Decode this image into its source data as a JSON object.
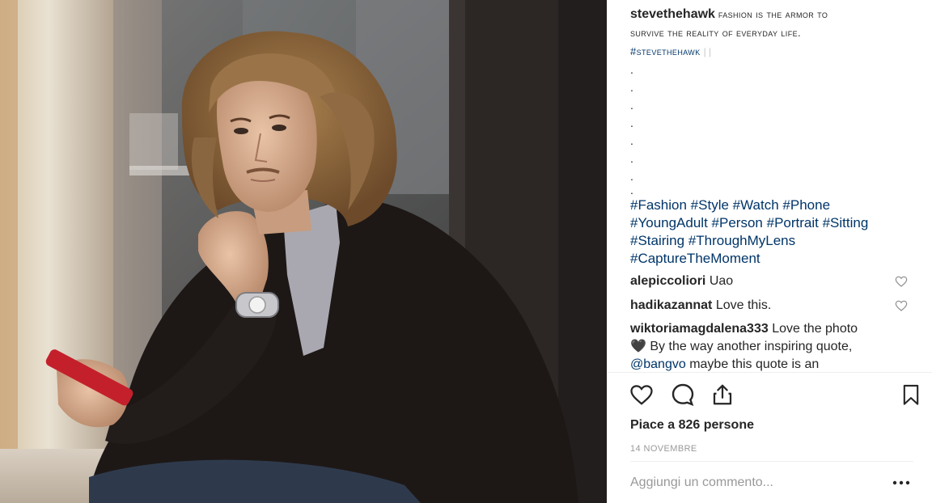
{
  "photo": {
    "icon": "portrait-photo"
  },
  "caption": {
    "username": "stevethehawk",
    "text_line1": "fashion is the armor to",
    "text_line2": "survive the reality of everyday life.",
    "tag": "#stevethehawk",
    "tag_sep": "| |",
    "dots": [
      ".",
      ".",
      ".",
      ".",
      ".",
      ".",
      ".",
      "."
    ],
    "hashtags": [
      [
        "#Fashion",
        "#Style",
        "#Watch",
        "#Phone"
      ],
      [
        "#YoungAdult",
        "#Person",
        "#Portrait",
        "#Sitting"
      ],
      [
        "#Stairing",
        "#ThroughMyLens"
      ],
      [
        "#CaptureTheMoment"
      ]
    ]
  },
  "comments": [
    {
      "user": "alepiccoliori",
      "text": "Uao"
    },
    {
      "user": "hadikazannat",
      "text": "Love this."
    },
    {
      "user": "wiktoriamagdalena333",
      "text": "Love the photo",
      "line2_emoji": "🖤",
      "line2_text": "By the way another inspiring quote,",
      "mention": "@bangvo",
      "line3_text": "maybe this quote is an"
    }
  ],
  "actions": {
    "likes_text": "Piace a 826 persone",
    "date": "14 NOVEMBRE"
  },
  "comment_box": {
    "placeholder": "Aggiungi un commento..."
  },
  "colors": {
    "link": "#003569",
    "text": "#262626",
    "muted": "#999999",
    "divider": "#efefef"
  }
}
